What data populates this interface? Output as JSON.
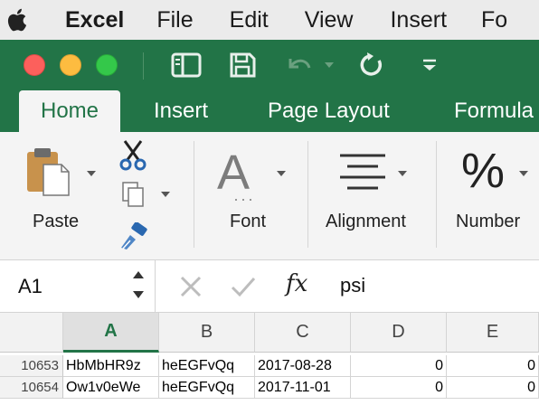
{
  "menubar": {
    "app_name": "Excel",
    "items": [
      "File",
      "Edit",
      "View",
      "Insert",
      "Fo"
    ]
  },
  "ribbon_tabs": [
    "Home",
    "Insert",
    "Page Layout",
    "Formula"
  ],
  "ribbon": {
    "paste_label": "Paste",
    "font_label": "Font",
    "alignment_label": "Alignment",
    "number_label": "Number",
    "font_icon_glyph": "A",
    "number_icon_glyph": "%"
  },
  "formula_bar": {
    "name_box": "A1",
    "fx_label": "fx",
    "content": "psi"
  },
  "grid": {
    "columns": [
      "A",
      "B",
      "C",
      "D",
      "E"
    ],
    "rows": [
      {
        "row_number": "10653",
        "cells": [
          "HbMbHR9z",
          "heEGFvQq",
          "2017-08-28",
          "0",
          "0"
        ]
      },
      {
        "row_number": "10654",
        "cells": [
          "Ow1v0eWe",
          "heEGFvQq",
          "2017-11-01",
          "0",
          "0"
        ]
      }
    ]
  },
  "colors": {
    "excel_green": "#227447",
    "ribbon_bg": "#f4f4f4",
    "menubar_bg": "#ebebeb"
  }
}
